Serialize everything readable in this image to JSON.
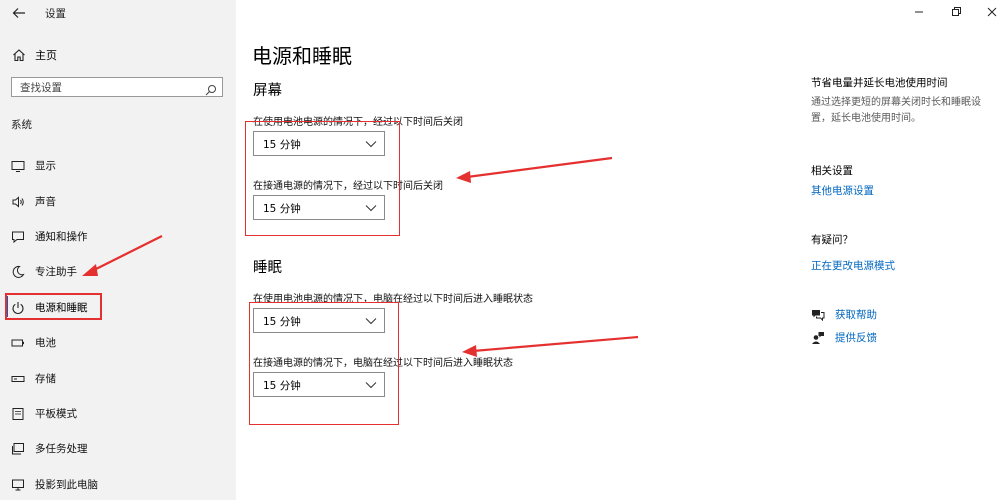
{
  "window": {
    "title": "设置"
  },
  "sidebar": {
    "home_label": "主页",
    "search_placeholder": "查找设置",
    "section_title": "系统",
    "items": [
      {
        "label": "显示",
        "icon": "monitor-icon"
      },
      {
        "label": "声音",
        "icon": "speaker-icon"
      },
      {
        "label": "通知和操作",
        "icon": "notification-icon"
      },
      {
        "label": "专注助手",
        "icon": "moon-icon"
      },
      {
        "label": "电源和睡眠",
        "icon": "power-icon",
        "active": true
      },
      {
        "label": "电池",
        "icon": "battery-icon"
      },
      {
        "label": "存储",
        "icon": "storage-icon"
      },
      {
        "label": "平板模式",
        "icon": "tablet-icon"
      },
      {
        "label": "多任务处理",
        "icon": "multitask-icon"
      },
      {
        "label": "投影到此电脑",
        "icon": "project-icon"
      }
    ]
  },
  "main": {
    "title": "电源和睡眠",
    "screen": {
      "title": "屏幕",
      "battery_label": "在使用电池电源的情况下，经过以下时间后关闭",
      "battery_value": "15 分钟",
      "plugged_label": "在接通电源的情况下，经过以下时间后关闭",
      "plugged_value": "15 分钟"
    },
    "sleep": {
      "title": "睡眠",
      "battery_label": "在使用电池电源的情况下，电脑在经过以下时间后进入睡眠状态",
      "battery_value": "15 分钟",
      "plugged_label": "在接通电源的情况下，电脑在经过以下时间后进入睡眠状态",
      "plugged_value": "15 分钟"
    }
  },
  "right": {
    "battery_tip_title": "节省电量并延长电池使用时间",
    "battery_tip_desc": "通过选择更短的屏幕关闭时长和睡眠设置，延长电池使用时间。",
    "related_title": "相关设置",
    "related_link": "其他电源设置",
    "question_title": "有疑问？",
    "question_link": "正在更改电源模式",
    "help_label": "获取帮助",
    "feedback_label": "提供反馈"
  },
  "colors": {
    "accent": "#0067c0",
    "annotation": "#e53030",
    "sidebar_bg": "#f2f2f2"
  }
}
